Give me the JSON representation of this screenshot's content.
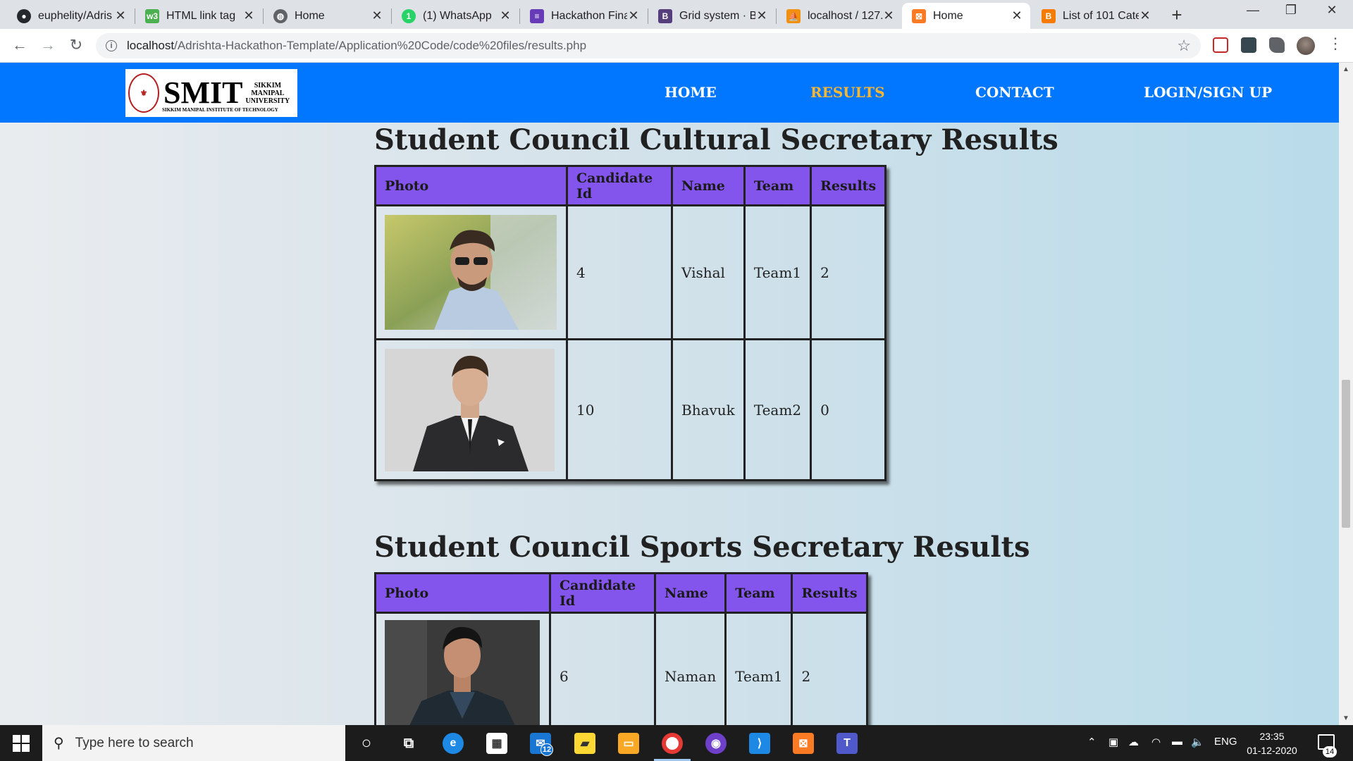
{
  "browser": {
    "tabs": [
      {
        "title": "euphelity/Adris",
        "icon": "github-icon",
        "color": "#24292e",
        "active": false
      },
      {
        "title": "HTML link tag",
        "icon": "w3schools-icon",
        "color": "#4caf50",
        "active": false
      },
      {
        "title": "Home",
        "icon": "globe-icon",
        "color": "#5f6368",
        "active": false
      },
      {
        "title": "(1) WhatsApp",
        "icon": "whatsapp-icon",
        "color": "#25d366",
        "active": false,
        "badge": "1"
      },
      {
        "title": "Hackathon Fina",
        "icon": "forms-icon",
        "color": "#673ab7",
        "active": false
      },
      {
        "title": "Grid system · B",
        "icon": "bootstrap-icon",
        "color": "#563d7c",
        "active": false,
        "letter": "B"
      },
      {
        "title": "localhost / 127.",
        "icon": "phpmyadmin-icon",
        "color": "#f29111",
        "active": false
      },
      {
        "title": "Home",
        "icon": "xampp-icon",
        "color": "#fb7a24",
        "active": true
      },
      {
        "title": "List of 101 Cate",
        "icon": "blogger-icon",
        "color": "#f57c00",
        "active": false
      }
    ],
    "url_host": "localhost",
    "url_path": "/Adrishta-Hackathon-Template/Application%20Code/code%20files/results.php"
  },
  "site": {
    "logo": {
      "main": "SMIT",
      "side": [
        "SIKKIM",
        "MANIPAL",
        "UNIVERSITY"
      ],
      "bottom": "SIKKIM MANIPAL INSTITUTE OF TECHNOLOGY"
    },
    "nav": {
      "home": "HOME",
      "results": "RESULTS",
      "contact": "CONTACT",
      "login": "LOGIN/SIGN UP",
      "active_color": "#f7b733"
    }
  },
  "sections": [
    {
      "title": "Student Council Cultural Secretary Results",
      "headers": [
        "Photo",
        "Candidate Id",
        "Name",
        "Team",
        "Results"
      ],
      "rows": [
        {
          "photo": "candidate-photo-vishal",
          "id": "4",
          "name": "Vishal",
          "team": "Team1",
          "result": "2"
        },
        {
          "photo": "candidate-photo-bhavuk",
          "id": "10",
          "name": "Bhavuk",
          "team": "Team2",
          "result": "0"
        }
      ]
    },
    {
      "title": "Student Council Sports Secretary Results",
      "headers": [
        "Photo",
        "Candidate Id",
        "Name",
        "Team",
        "Results"
      ],
      "rows": [
        {
          "photo": "candidate-photo-naman",
          "id": "6",
          "name": "Naman",
          "team": "Team1",
          "result": "2"
        }
      ]
    }
  ],
  "taskbar": {
    "search_placeholder": "Type here to search",
    "mail_badge": "12",
    "tray_lang": "ENG",
    "time": "23:35",
    "date": "01-12-2020",
    "notification_count": "14"
  },
  "colors": {
    "site_nav": "#0177ff",
    "table_header": "#8455ec"
  }
}
